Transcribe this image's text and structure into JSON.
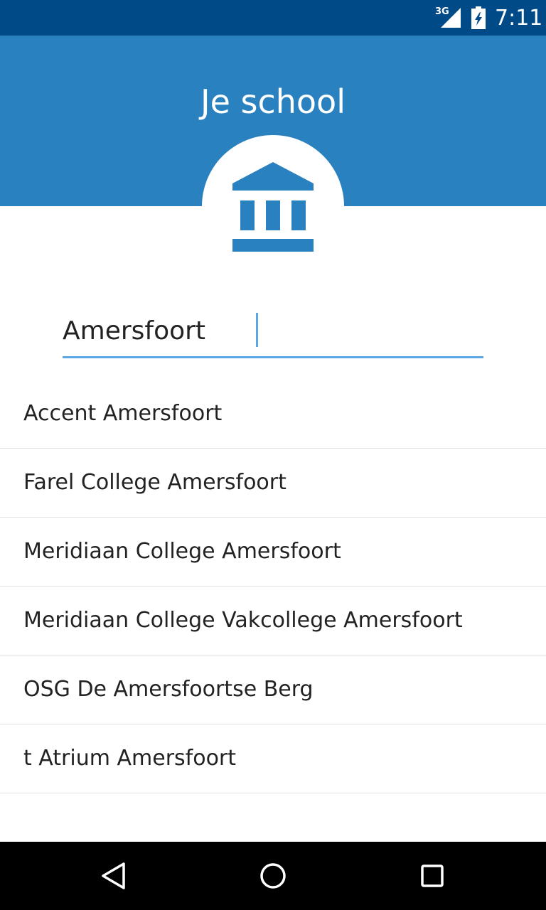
{
  "status_bar": {
    "network_type": "3G",
    "time": "7:11",
    "icons": [
      "signal-icon",
      "battery-icon"
    ]
  },
  "header": {
    "title": "Je school",
    "icon": "school-building-icon",
    "color": "#2a81bf"
  },
  "search": {
    "value": "Amersfoort",
    "accent_color": "#5aa9e6"
  },
  "results": [
    "Accent Amersfoort",
    "Farel College Amersfoort",
    "Meridiaan College Amersfoort",
    "Meridiaan College Vakcollege Amersfoort",
    "OSG De Amersfoortse Berg",
    "t Atrium Amersfoort"
  ],
  "nav_bar": {
    "icons": [
      "back-icon",
      "home-icon",
      "recents-icon"
    ]
  }
}
